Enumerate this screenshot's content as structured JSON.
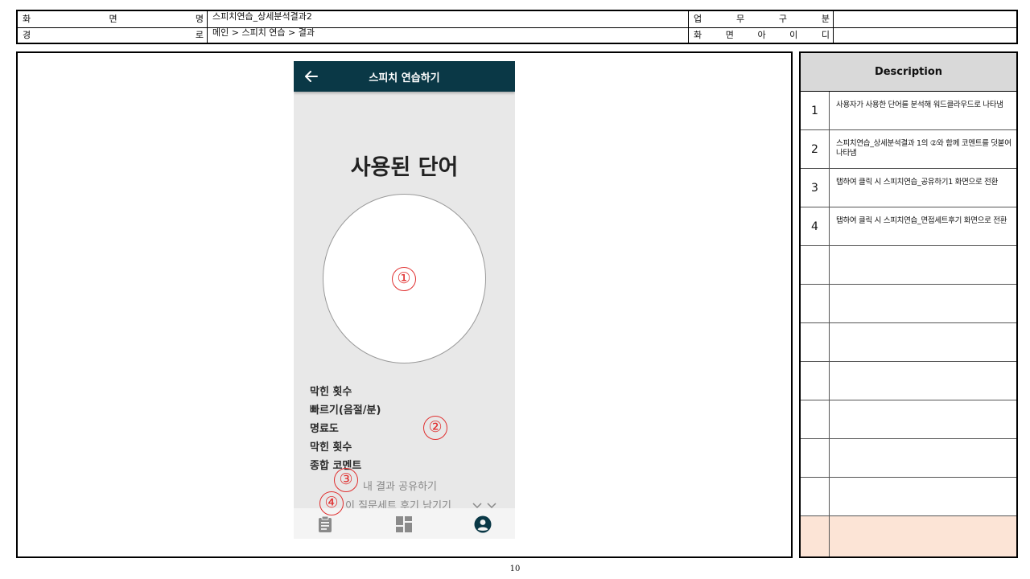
{
  "header": {
    "screen_name_label": "화면명",
    "screen_name": "스피치연습_상세분석결과2",
    "path_label": "경로",
    "path": "메인 > 스피치 연습 > 결과",
    "category_label": "업무구분",
    "category_value": "",
    "screen_id_label": "화면아이디",
    "screen_id_value": ""
  },
  "phone": {
    "appbar_title": "스피치 연습하기",
    "title": "사용된 단어",
    "metrics": [
      "막힌 횟수",
      "빠르기(음절/분)",
      "명료도",
      "막힌 횟수",
      "종합 코멘트"
    ],
    "share_link": "내 결과 공유하기",
    "review_link": "이 질문세트 후기 남기기",
    "nav_icons": [
      "clipboard-icon",
      "dashboard-icon",
      "account-icon"
    ],
    "appbar_color": "#0a3846"
  },
  "markers": [
    "①",
    "②",
    "③",
    "④"
  ],
  "description": {
    "header": "Description",
    "rows": [
      {
        "num": "1",
        "text": "사용자가 사용한 단어를 분석해 워드클라우드로 나타냄"
      },
      {
        "num": "2",
        "text": "스피치연습_상세분석결과 1의 ②와 함께 코멘트를 덧붙여 나타냄"
      },
      {
        "num": "3",
        "text": "탭하여 클릭 시 스피치연습_공유하기1 화면으로 전환"
      },
      {
        "num": "4",
        "text": "탭하여 클릭 시 스피치연습_면접세트후기 화면으로 전환"
      },
      {
        "num": "",
        "text": ""
      },
      {
        "num": "",
        "text": ""
      },
      {
        "num": "",
        "text": ""
      },
      {
        "num": "",
        "text": ""
      },
      {
        "num": "",
        "text": ""
      },
      {
        "num": "",
        "text": ""
      },
      {
        "num": "",
        "text": ""
      },
      {
        "num": "",
        "text": ""
      }
    ],
    "last_row_color": "#fce4d6"
  },
  "page_number": "10"
}
